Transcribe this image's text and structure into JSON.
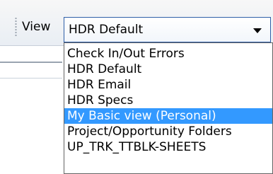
{
  "toolbar": {
    "view_label": "View"
  },
  "view_select": {
    "selected": "HDR Default",
    "options": [
      "Check In/Out Errors",
      "HDR Default",
      "HDR Email",
      "HDR Specs",
      "My Basic view (Personal)",
      "Project/Opportunity Folders",
      "UP_TRK_TTBLK-SHEETS"
    ],
    "highlighted_option": "My Basic view (Personal)"
  },
  "colors": {
    "highlight": "#3399ff",
    "select_border": "#2e5fa8"
  }
}
